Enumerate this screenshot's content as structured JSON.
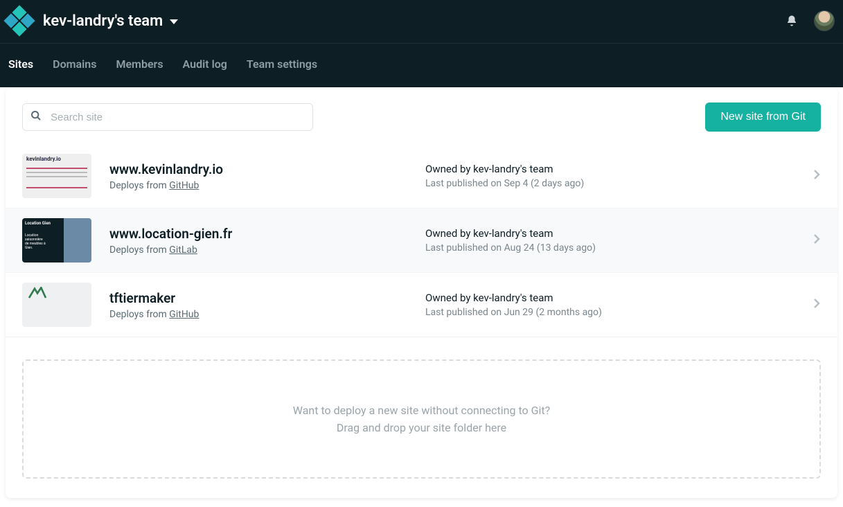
{
  "header": {
    "team_name": "kev-landry's team"
  },
  "tabs": [
    {
      "label": "Sites",
      "active": true
    },
    {
      "label": "Domains",
      "active": false
    },
    {
      "label": "Members",
      "active": false
    },
    {
      "label": "Audit log",
      "active": false
    },
    {
      "label": "Team settings",
      "active": false
    }
  ],
  "toolbar": {
    "search_placeholder": "Search site",
    "new_site_label": "New site from Git"
  },
  "sites": [
    {
      "name": "www.kevinlandry.io",
      "deploys_prefix": "Deploys from ",
      "deploy_source": "GitHub",
      "owner": "Owned by kev-landry's team",
      "published": "Last published on Sep 4 (2 days ago)",
      "thumb_variant": "thumb1",
      "alt": false
    },
    {
      "name": "www.location-gien.fr",
      "deploys_prefix": "Deploys from ",
      "deploy_source": "GitLab",
      "owner": "Owned by kev-landry's team",
      "published": "Last published on Aug 24 (13 days ago)",
      "thumb_variant": "thumb2",
      "alt": true
    },
    {
      "name": "tftiermaker",
      "deploys_prefix": "Deploys from ",
      "deploy_source": "GitHub",
      "owner": "Owned by kev-landry's team",
      "published": "Last published on Jun 29 (2 months ago)",
      "thumb_variant": "thumb3",
      "alt": false
    }
  ],
  "dropzone": {
    "line1": "Want to deploy a new site without connecting to Git?",
    "line2": "Drag and drop your site folder here"
  }
}
